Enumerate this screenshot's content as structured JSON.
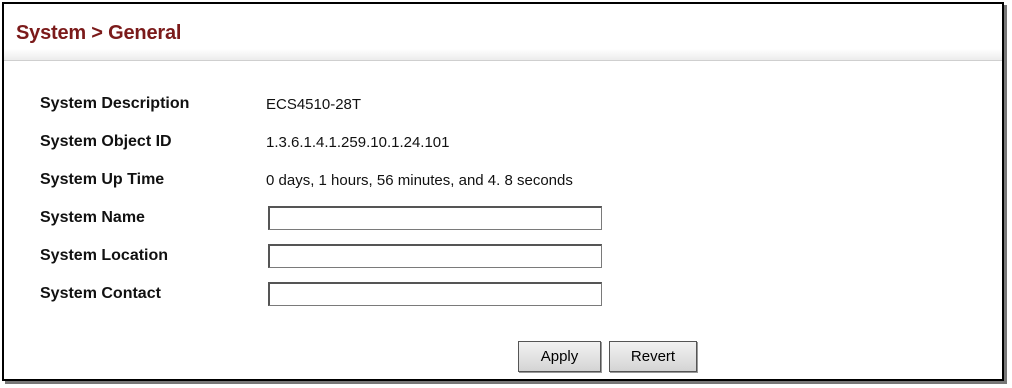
{
  "header": {
    "title": "System > General"
  },
  "fields": {
    "description": {
      "label": "System Description",
      "value": "ECS4510-28T"
    },
    "object_id": {
      "label": "System Object ID",
      "value": "1.3.6.1.4.1.259.10.1.24.101"
    },
    "up_time": {
      "label": "System Up Time",
      "value": "0 days, 1 hours, 56 minutes, and 4. 8 seconds"
    },
    "name": {
      "label": "System Name",
      "value": ""
    },
    "location": {
      "label": "System Location",
      "value": ""
    },
    "contact": {
      "label": "System Contact",
      "value": ""
    }
  },
  "actions": {
    "apply_label": "Apply",
    "revert_label": "Revert"
  },
  "colors": {
    "title": "#7b1a1a",
    "border": "#000000"
  }
}
